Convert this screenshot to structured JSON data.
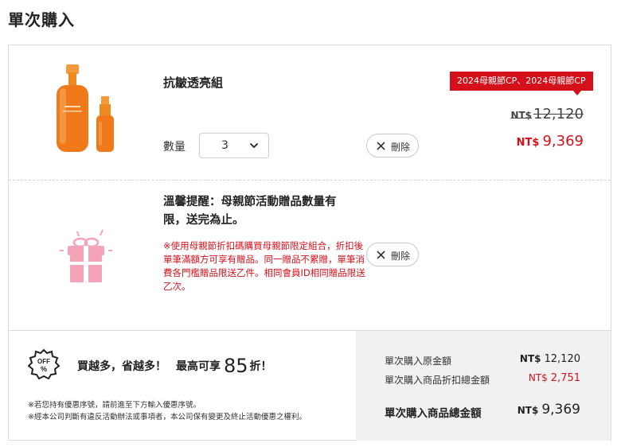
{
  "page": {
    "title": "單次購入"
  },
  "product": {
    "name": "抗皺透亮組",
    "image_icon": "serum-bottles-image",
    "promo_tag": "2024母親節CP、2024母親節CP",
    "qty_label": "數量",
    "qty_value": "3",
    "currency": "NT$",
    "price_original": "12,120",
    "price_sale": "9,369",
    "remove_label": "刪除"
  },
  "gift": {
    "icon": "gift-box-icon",
    "title": "溫馨提醒：母親節活動贈品數量有限，送完為止。",
    "note": "※使用母親節折扣碼購買母親節限定組合，折扣後單筆滿額方可享有贈品。同一贈品不累贈，單筆消費各門檻贈品限送乙件。相同會員ID相同贈品限送乙次。",
    "remove_label": "刪除"
  },
  "promo": {
    "badge_text": "OFF %",
    "headline": "買越多，省越多！",
    "max_prefix": "最高可享",
    "max_value": "85",
    "max_suffix": "折！",
    "disclaimer_1": "※若您持有優惠序號，請前進至下方輸入優惠序號。",
    "disclaimer_2": "※經本公司判斷有違反活動辦法或事項者，本公司保有變更及終止活動優惠之權利。"
  },
  "summary": {
    "original_label": "單次購入原金額",
    "original_currency": "NT$",
    "original_value": "12,120",
    "discount_label": "單次購入商品折扣總金額",
    "discount_currency": "NT$",
    "discount_value": "2,751",
    "total_label": "單次購入商品總金額",
    "total_currency": "NT$",
    "total_value": "9,369"
  },
  "colors": {
    "accent_red": "#d4111b",
    "gift_pink": "#f4a3b8",
    "product_orange": "#f07a1a"
  }
}
